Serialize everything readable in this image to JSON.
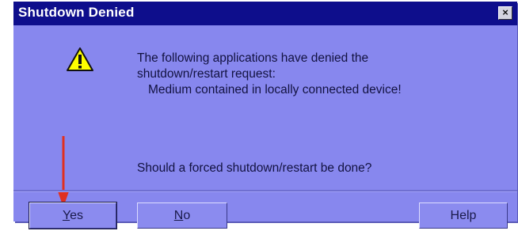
{
  "window": {
    "title": "Shutdown Denied",
    "close_glyph": "×"
  },
  "message": {
    "line1": "The following applications have denied the",
    "line2": "shutdown/restart request:",
    "line3": "Medium contained in locally connected device!",
    "question": "Should a forced shutdown/restart be done?"
  },
  "icons": {
    "warning": "warning-icon",
    "annotation_arrow": "arrow-down-icon"
  },
  "buttons": {
    "yes": {
      "accel": "Y",
      "rest": "es"
    },
    "no": {
      "accel": "N",
      "rest": "o"
    },
    "help": "Help"
  },
  "colors": {
    "titlebar": "#0e0e8c",
    "dialog": "#8787ee",
    "warning_fill": "#ffff00",
    "arrow": "#e03020"
  }
}
